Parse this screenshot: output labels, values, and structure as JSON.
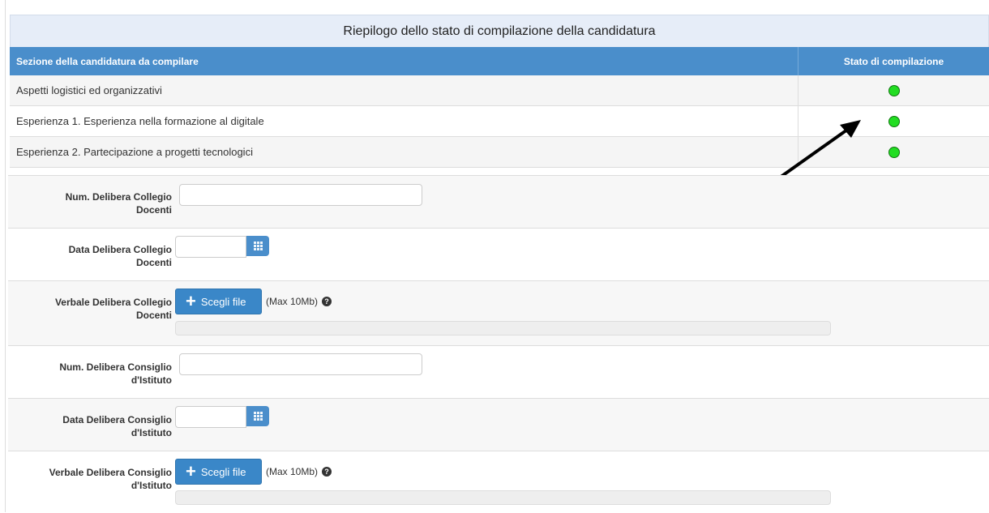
{
  "summary": {
    "title": "Riepilogo dello stato di compilazione della candidatura",
    "col_section": "Sezione della candidatura da compilare",
    "col_status": "Stato di compilazione",
    "status_color": "#22dd22",
    "rows": [
      {
        "label": "Aspetti logistici ed organizzativi",
        "status": "complete"
      },
      {
        "label": "Esperienza 1. Esperienza nella formazione al digitale",
        "status": "complete"
      },
      {
        "label": "Esperienza 2. Partecipazione a progetti tecnologici",
        "status": "complete"
      }
    ]
  },
  "annotation": {
    "icon": "arrow-pointer-icon"
  },
  "form": {
    "num_delibera_collegio": {
      "label_1": "Num. Delibera Collegio",
      "label_2": "Docenti",
      "value": ""
    },
    "data_delibera_collegio": {
      "label_1": "Data Delibera Collegio",
      "label_2": "Docenti",
      "value": "",
      "icon": "calendar-icon"
    },
    "verbale_delibera_collegio": {
      "label_1": "Verbale Delibera Collegio",
      "label_2": "Docenti",
      "button": "Scegli file",
      "note": "(Max 10Mb)",
      "help_icon": "question-circle-icon",
      "progress": 0
    },
    "num_delibera_consiglio": {
      "label_1": "Num. Delibera Consiglio",
      "label_2": "d'Istituto",
      "value": ""
    },
    "data_delibera_consiglio": {
      "label_1": "Data Delibera Consiglio",
      "label_2": "d'Istituto",
      "value": "",
      "icon": "calendar-icon"
    },
    "verbale_delibera_consiglio": {
      "label_1": "Verbale Delibera Consiglio",
      "label_2": "d'Istituto",
      "button": "Scegli file",
      "note": "(Max 10Mb)",
      "help_icon": "question-circle-icon",
      "progress": 0
    }
  }
}
